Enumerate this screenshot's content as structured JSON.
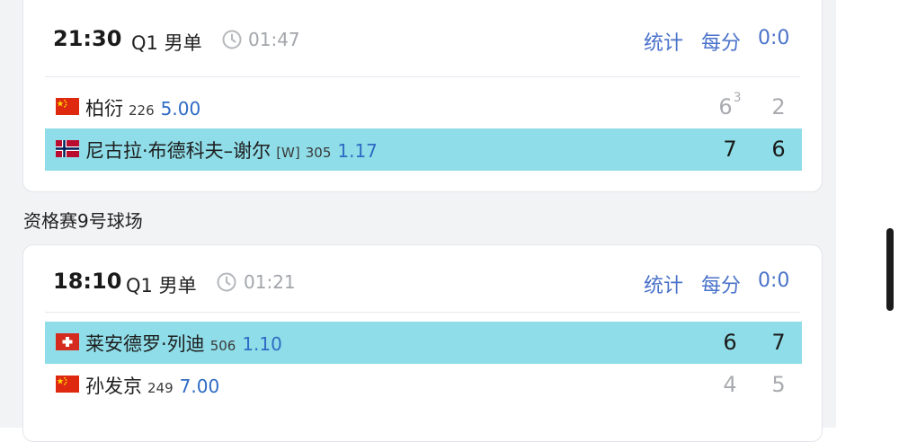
{
  "matches": [
    {
      "time": "21:30",
      "round": "Q1 男单",
      "elapsed": "01:47",
      "stats_label": "统计",
      "points_label": "每分",
      "point_score": "0:0",
      "players": [
        {
          "flag": "china-flag",
          "name": "柏衍",
          "seed": "",
          "rank": "226",
          "odds": "5.00",
          "set1": "6",
          "set1_tiebreak": "3",
          "set2": "2",
          "winner": false
        },
        {
          "flag": "norway-flag",
          "name": "尼古拉·布德科夫–谢尔",
          "seed": "[W]",
          "rank": "305",
          "odds": "1.17",
          "set1": "7",
          "set1_tiebreak": "",
          "set2": "6",
          "winner": true
        }
      ]
    },
    {
      "time": "18:10",
      "round": "Q1 男单",
      "elapsed": "01:21",
      "stats_label": "统计",
      "points_label": "每分",
      "point_score": "0:0",
      "players": [
        {
          "flag": "switzerland-flag",
          "name": "莱安德罗·列迪",
          "seed": "",
          "rank": "506",
          "odds": "1.10",
          "set1": "6",
          "set1_tiebreak": "",
          "set2": "7",
          "winner": true
        },
        {
          "flag": "china-flag",
          "name": "孙发京",
          "seed": "",
          "rank": "249",
          "odds": "7.00",
          "set1": "4",
          "set1_tiebreak": "",
          "set2": "5",
          "winner": false
        }
      ]
    }
  ],
  "section_label": "资格赛9号球场",
  "colors": {
    "highlight_row": "#8fdde8",
    "link_blue": "#4a72c9",
    "odds_blue": "#2f6bc4",
    "muted_gray": "#a9abb0"
  }
}
